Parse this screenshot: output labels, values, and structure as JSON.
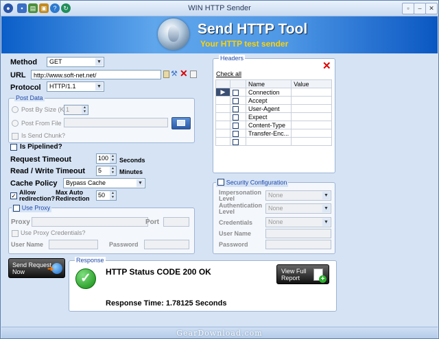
{
  "window": {
    "title": "WIN HTTP Sender"
  },
  "banner": {
    "title": "Send HTTP Tool",
    "subtitle": "Your HTTP test sender"
  },
  "method": {
    "label": "Method",
    "value": "GET"
  },
  "url": {
    "label": "URL",
    "value": "http://www.soft-net.net/"
  },
  "protocol": {
    "label": "Protocol",
    "value": "HTTP/1.1"
  },
  "post_data": {
    "legend": "Post Data",
    "by_size_label": "Post By Size (KB)",
    "size_value": "1",
    "from_file_label": "Post From File",
    "chunk_label": "Is Send Chunk?"
  },
  "pipelined": {
    "label": "Is Pipelined?"
  },
  "request_timeout": {
    "label": "Request Timeout",
    "value": "100",
    "unit": "Seconds"
  },
  "rw_timeout": {
    "label": "Read / Write Timeout",
    "value": "5",
    "unit": "Minutes"
  },
  "cache_policy": {
    "label": "Cache Policy",
    "value": "Bypass Cache"
  },
  "redirection": {
    "allow_label_1": "Allow",
    "allow_label_2": "redirection?",
    "max_label_1": "Max Auto",
    "max_label_2": "Redirection",
    "max_value": "50"
  },
  "proxy": {
    "legend": "Use Proxy",
    "proxy_label": "Proxy",
    "port_label": "Port",
    "creds_label": "Use Proxy Credentials?",
    "username_label": "User Name",
    "password_label": "Password"
  },
  "headers": {
    "legend": "Headers",
    "check_all": "Check all",
    "col_name": "Name",
    "col_value": "Value",
    "rows": [
      "Connection",
      "Accept",
      "User-Agent",
      "Expect",
      "Content-Type",
      "Transfer-Enc..."
    ]
  },
  "security": {
    "legend": "Security Configuration",
    "impersonation_1": "Impersonation",
    "impersonation_2": "Level",
    "impersonation_value": "None",
    "authentication_1": "Authentication",
    "authentication_2": "Level",
    "authentication_value": "None",
    "credentials_label": "Credentials",
    "credentials_value": "None",
    "username_label": "User Name",
    "password_label": "Password"
  },
  "send_button": {
    "line1": "Send Request",
    "line2": "Now"
  },
  "response": {
    "legend": "Response",
    "status": "HTTP Status CODE 200 OK",
    "time": "Response Time: 1.78125 Seconds",
    "view_full_1": "View Full",
    "view_full_2": "Report"
  },
  "watermark": "GearDownload.com",
  "colors": {
    "banner_blue": "#0a5ec8",
    "subtitle_yellow": "#ffd200",
    "legend_blue": "#1f49a8",
    "ok_green": "#1aa01a"
  }
}
